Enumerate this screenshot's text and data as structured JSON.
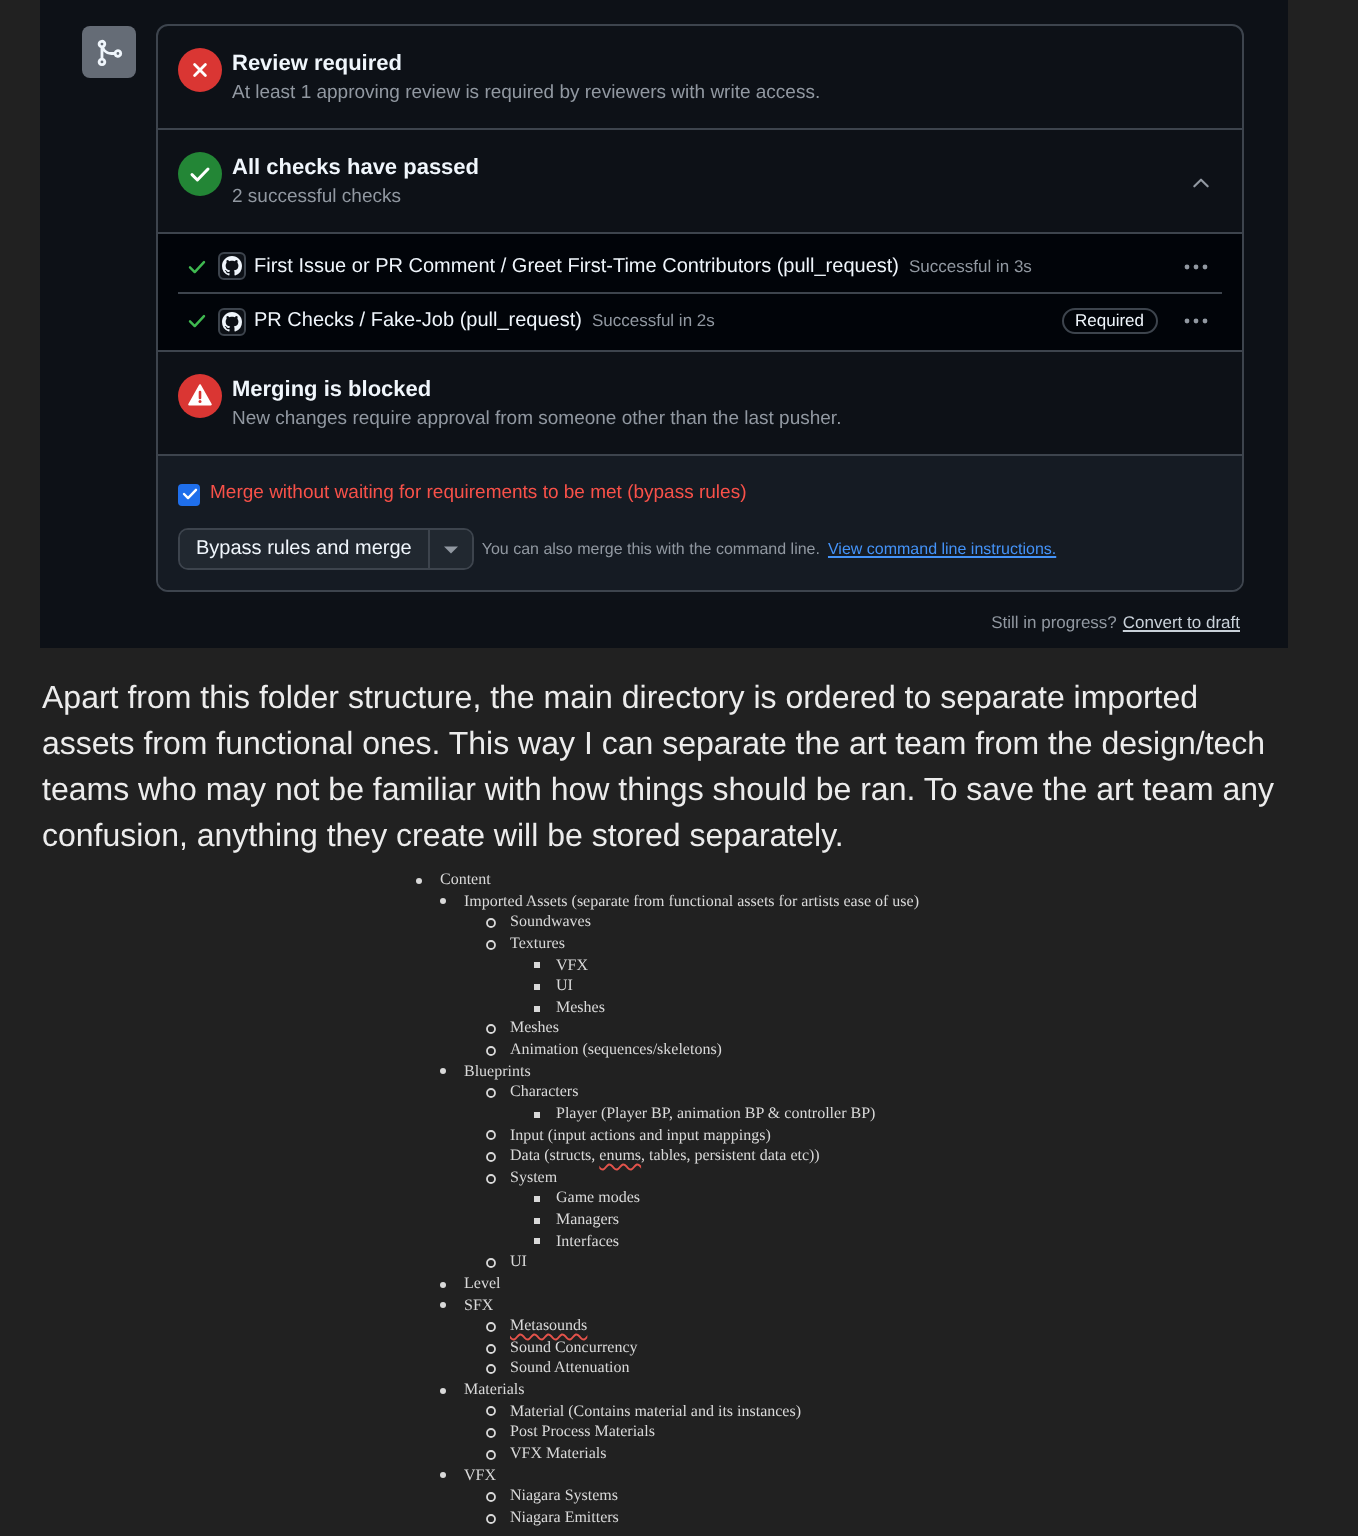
{
  "merge_box": {
    "sections": [
      {
        "kind": "error",
        "title": "Review required",
        "subtitle": "At least 1 approving review is required by reviewers with write access."
      },
      {
        "kind": "success",
        "title": "All checks have passed",
        "subtitle": "2 successful checks",
        "expanded": true,
        "checks": [
          {
            "name": "First Issue or PR Comment / Greet First-Time Contributors (pull_request)",
            "passed": true,
            "duration": "Successful in 3s"
          },
          {
            "name": "PR Checks / Fake-Job (pull_request)",
            "passed": true,
            "duration": "Successful in 2s",
            "badge": "Required"
          }
        ]
      },
      {
        "kind": "warning",
        "title": "Merging is blocked",
        "subtitle": "New changes require approval from someone other than the last pusher."
      }
    ],
    "bypass": {
      "label": "Merge without waiting for requirements to be met (bypass rules)",
      "checked": true
    },
    "merge_button": "Bypass rules and merge",
    "hint": "You can also merge this with the command line.",
    "hint_link": "View command line instructions."
  },
  "draft_prompt": {
    "text": "Still in progress?",
    "link": "Convert to draft"
  },
  "paragraph": "Apart from this folder structure, the main directory is ordered to separate imported assets from functional ones. This way I can separate the art team from the design/tech teams who may not be familiar with how things should be ran. To save the art team any confusion, anything they create will be stored separately.",
  "outline": [
    {
      "text": "Content",
      "children": [
        {
          "text": "Imported Assets (separate from functional assets for artists ease of use)",
          "children": [
            {
              "text": "Soundwaves"
            },
            {
              "text": "Textures",
              "children": [
                {
                  "text": "VFX"
                },
                {
                  "text": "UI"
                },
                {
                  "text": "Meshes"
                }
              ]
            },
            {
              "text": "Meshes"
            },
            {
              "text": "Animation (sequences/skeletons)"
            }
          ]
        },
        {
          "text": "Blueprints",
          "children": [
            {
              "text": "Characters",
              "children": [
                {
                  "text": "Player (Player BP, animation BP & controller BP)"
                }
              ]
            },
            {
              "text": "Input (input actions and input mappings)"
            },
            {
              "parts": [
                {
                  "text": "Data (structs, "
                },
                {
                  "text": "enums",
                  "misspelled": true
                },
                {
                  "text": ", tables, persistent data etc))"
                }
              ]
            },
            {
              "text": "System",
              "children": [
                {
                  "text": "Game modes"
                },
                {
                  "text": "Managers"
                },
                {
                  "text": "Interfaces"
                }
              ]
            },
            {
              "text": "UI"
            }
          ]
        },
        {
          "text": "Level"
        },
        {
          "text": "SFX",
          "children": [
            {
              "parts": [
                {
                  "text": "Metasounds",
                  "misspelled": true
                }
              ]
            },
            {
              "text": "Sound Concurrency"
            },
            {
              "text": "Sound Attenuation"
            }
          ]
        },
        {
          "text": "Materials",
          "children": [
            {
              "text": "Material (Contains material and its instances)"
            },
            {
              "text": "Post Process Materials"
            },
            {
              "text": "VFX Materials"
            }
          ]
        },
        {
          "text": "VFX",
          "children": [
            {
              "text": "Niagara Systems"
            },
            {
              "text": "Niagara Emitters"
            }
          ]
        }
      ]
    }
  ]
}
